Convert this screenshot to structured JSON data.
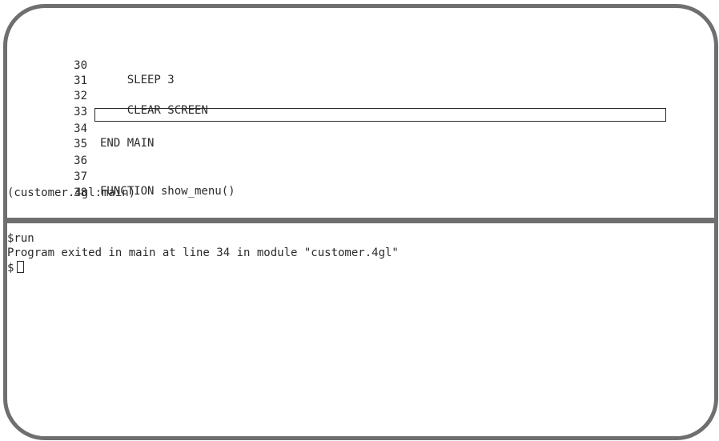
{
  "source": {
    "lines": [
      {
        "num": "30",
        "code": "    SLEEP 3"
      },
      {
        "num": "31",
        "code": ""
      },
      {
        "num": "32",
        "code": "    CLEAR SCREEN"
      },
      {
        "num": "33",
        "code": ""
      },
      {
        "num": "34",
        "code": "END MAIN"
      },
      {
        "num": "35",
        "code": ""
      },
      {
        "num": "36",
        "code": ""
      },
      {
        "num": "37",
        "code": "FUNCTION show_menu()"
      },
      {
        "num": "38",
        "code": ""
      }
    ],
    "current_line": "34",
    "context": "(customer.4gl:main)"
  },
  "command": {
    "lines": [
      "$run",
      "Program exited in main at line 34 in module \"customer.4gl\""
    ],
    "prompt": "$"
  }
}
